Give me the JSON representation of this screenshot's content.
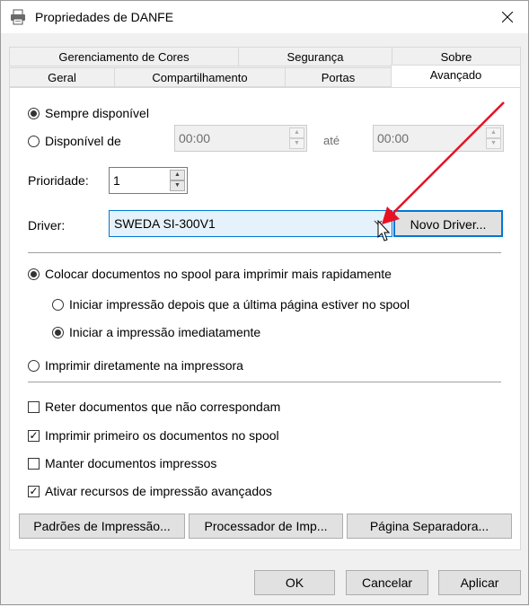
{
  "window": {
    "title": "Propriedades de DANFE"
  },
  "tabs": {
    "row1": [
      "Gerenciamento de Cores",
      "Segurança",
      "Sobre"
    ],
    "row2": [
      "Geral",
      "Compartilhamento",
      "Portas",
      "Avançado"
    ],
    "active": "Avançado"
  },
  "availability": {
    "always_label": "Sempre disponível",
    "from_label": "Disponível de",
    "from_value": "00:00",
    "until_label": "até",
    "until_value": "00:00",
    "selected": "always"
  },
  "priority": {
    "label": "Prioridade:",
    "value": "1"
  },
  "driver": {
    "label": "Driver:",
    "value": "SWEDA SI-300V1",
    "new_driver_button": "Novo Driver..."
  },
  "spool": {
    "spool_label": "Colocar documentos no spool para imprimir mais rapidamente",
    "start_after_label": "Iniciar impressão depois que a última página estiver no spool",
    "start_now_label": "Iniciar a impressão imediatamente",
    "direct_label": "Imprimir diretamente na impressora"
  },
  "options": [
    {
      "label": "Reter documentos que não correspondam",
      "checked": false
    },
    {
      "label": "Imprimir primeiro os documentos no spool",
      "checked": true
    },
    {
      "label": "Manter documentos impressos",
      "checked": false
    },
    {
      "label": "Ativar recursos de impressão avançados",
      "checked": true
    }
  ],
  "bottom_buttons": {
    "defaults": "Padrões de Impressão...",
    "processor": "Processador de Imp...",
    "separator": "Página Separadora..."
  },
  "dialog_buttons": {
    "ok": "OK",
    "cancel": "Cancelar",
    "apply": "Aplicar"
  },
  "colors": {
    "annotation_arrow": "#e81123",
    "focus_blue": "#0078d7"
  }
}
